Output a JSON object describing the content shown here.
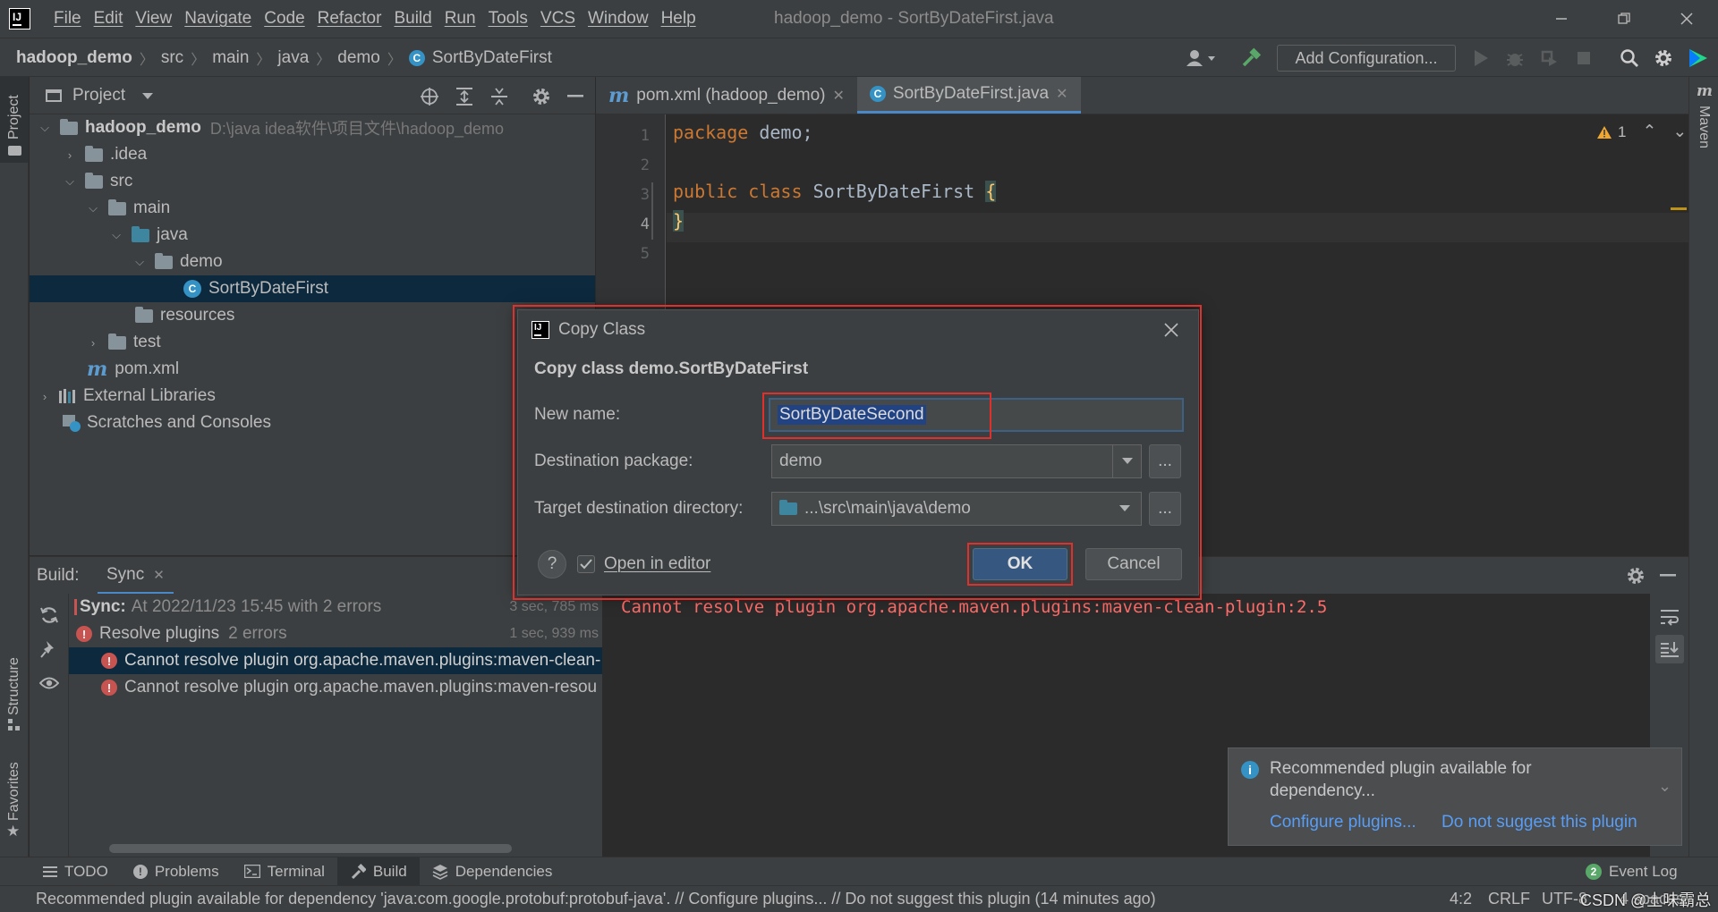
{
  "menu": {
    "items": [
      "File",
      "Edit",
      "View",
      "Navigate",
      "Code",
      "Refactor",
      "Build",
      "Run",
      "Tools",
      "VCS",
      "Window",
      "Help"
    ],
    "window_title": "hadoop_demo - SortByDateFirst.java"
  },
  "navbar": {
    "crumbs": [
      "hadoop_demo",
      "src",
      "main",
      "java",
      "demo",
      "SortByDateFirst"
    ],
    "add_configuration": "Add Configuration..."
  },
  "left_strip": {
    "project": "Project",
    "structure": "Structure",
    "favorites": "Favorites"
  },
  "right_strip": {
    "maven": "Maven"
  },
  "project_panel": {
    "title": "Project",
    "tree": {
      "root_name": "hadoop_demo",
      "root_path": "D:\\java idea软件\\项目文件\\hadoop_demo",
      "idea": ".idea",
      "src": "src",
      "main": "main",
      "java": "java",
      "demo": "demo",
      "class": "SortByDateFirst",
      "resources": "resources",
      "test": "test",
      "pom": "pom.xml",
      "ext_libs": "External Libraries",
      "scratches": "Scratches and Consoles"
    }
  },
  "editor": {
    "tabs": [
      {
        "label": "pom.xml (hadoop_demo)",
        "icon": "maven-icon"
      },
      {
        "label": "SortByDateFirst.java",
        "icon": "class-icon"
      }
    ],
    "line_numbers": [
      "1",
      "2",
      "3",
      "4",
      "5"
    ],
    "code": {
      "l1_kw": "package",
      "l1_rest": " demo;",
      "l3_kw1": "public",
      "l3_kw2": "class",
      "l3_name": "SortByDateFirst",
      "l3_brace": "{",
      "l4_brace": "}"
    },
    "warning_count": "1"
  },
  "dialog": {
    "title": "Copy Class",
    "heading": "Copy class demo.SortByDateFirst",
    "new_name_label": "New name:",
    "new_name_value": "SortByDateSecond",
    "dest_pkg_label": "Destination package:",
    "dest_pkg_value": "demo",
    "target_dir_label": "Target destination directory:",
    "target_dir_value": "...\\src\\main\\java\\demo",
    "open_in_editor": "Open in editor",
    "open_in_editor_checked": true,
    "ok": "OK",
    "cancel": "Cancel",
    "dots": "..."
  },
  "build_panel": {
    "title": "Build:",
    "tab": "Sync",
    "rows": [
      {
        "label": "Sync:",
        "detail": "At 2022/11/23 15:45 with 2 errors",
        "time": "3 sec, 785 ms"
      },
      {
        "label": "Resolve plugins",
        "detail": "2 errors",
        "time": "1 sec, 939 ms"
      },
      {
        "label": "Cannot resolve plugin org.apache.maven.plugins:maven-clean-"
      },
      {
        "label": "Cannot resolve plugin org.apache.maven.plugins:maven-resou"
      }
    ],
    "output": "Cannot resolve plugin org.apache.maven.plugins:maven-clean-plugin:2.5"
  },
  "notification": {
    "text": "Recommended plugin available for dependency...",
    "link1": "Configure plugins...",
    "link2": "Do not suggest this plugin"
  },
  "bottom_tabs": [
    "TODO",
    "Problems",
    "Terminal",
    "Build",
    "Dependencies"
  ],
  "event_log": {
    "count": "2",
    "label": "Event Log"
  },
  "status": {
    "message": "Recommended plugin available for dependency 'java:com.google.protobuf:protobuf-java'. // Configure plugins... // Do not suggest this plugin (14 minutes ago)",
    "position": "4:2",
    "line_sep": "CRLF",
    "encoding": "UTF-8",
    "indent": "4 spaces",
    "watermark": "CSDN @土味霸总"
  },
  "colors": {
    "accent": "#4a88c7",
    "error": "#c75450",
    "highlight": "#e0302c"
  }
}
